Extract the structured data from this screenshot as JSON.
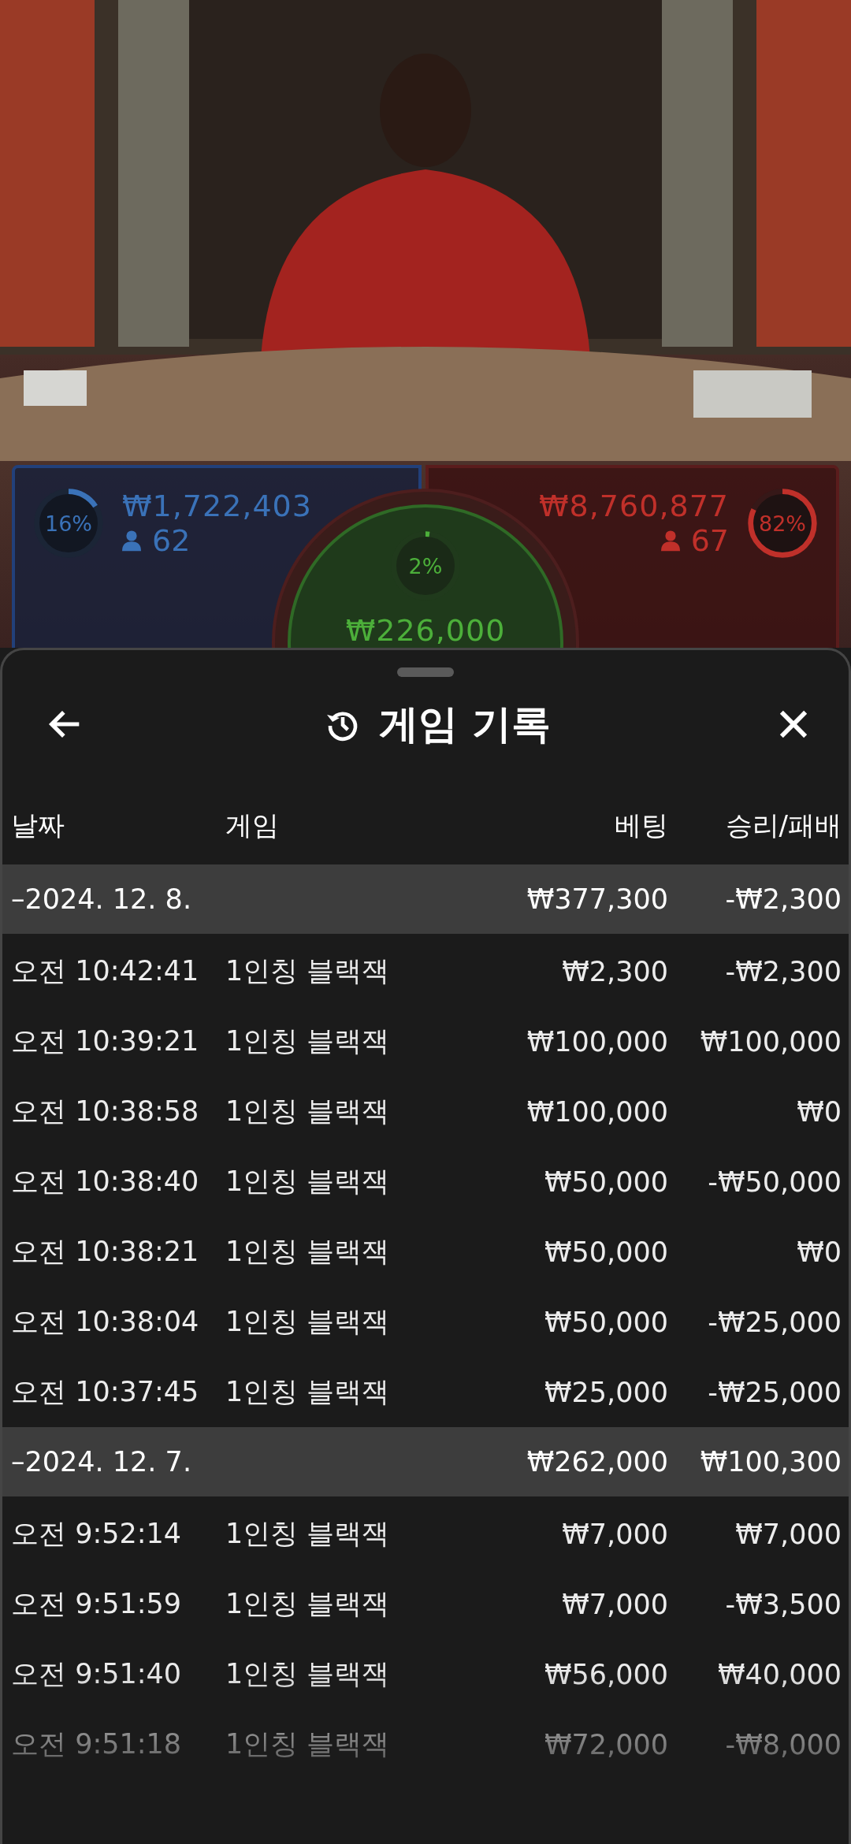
{
  "bets": {
    "player": {
      "percent": "16%",
      "level": 0.16,
      "amount": "₩1,722,403",
      "count": "62"
    },
    "tie": {
      "percent": "2%",
      "level": 0.02,
      "amount": "₩226,000"
    },
    "banker": {
      "percent": "82%",
      "level": 0.82,
      "amount": "₩8,760,877",
      "count": "67"
    }
  },
  "sheet": {
    "title": "게임 기록",
    "columns": [
      "날짜",
      "게임",
      "베팅",
      "승리/패배"
    ],
    "groups": [
      {
        "date": "–2024. 12. 8.",
        "bet": "₩377,300",
        "result": "-₩2,300",
        "rows": [
          {
            "time": "오전 10:42:41",
            "game": "1인칭 블랙잭",
            "bet": "₩2,300",
            "result": "-₩2,300"
          },
          {
            "time": "오전 10:39:21",
            "game": "1인칭 블랙잭",
            "bet": "₩100,000",
            "result": "₩100,000"
          },
          {
            "time": "오전 10:38:58",
            "game": "1인칭 블랙잭",
            "bet": "₩100,000",
            "result": "₩0"
          },
          {
            "time": "오전 10:38:40",
            "game": "1인칭 블랙잭",
            "bet": "₩50,000",
            "result": "-₩50,000"
          },
          {
            "time": "오전 10:38:21",
            "game": "1인칭 블랙잭",
            "bet": "₩50,000",
            "result": "₩0"
          },
          {
            "time": "오전 10:38:04",
            "game": "1인칭 블랙잭",
            "bet": "₩50,000",
            "result": "-₩25,000"
          },
          {
            "time": "오전 10:37:45",
            "game": "1인칭 블랙잭",
            "bet": "₩25,000",
            "result": "-₩25,000"
          }
        ]
      },
      {
        "date": "–2024. 12. 7.",
        "bet": "₩262,000",
        "result": "₩100,300",
        "rows": [
          {
            "time": "오전 9:52:14",
            "game": "1인칭 블랙잭",
            "bet": "₩7,000",
            "result": "₩7,000"
          },
          {
            "time": "오전 9:51:59",
            "game": "1인칭 블랙잭",
            "bet": "₩7,000",
            "result": "-₩3,500"
          },
          {
            "time": "오전 9:51:40",
            "game": "1인칭 블랙잭",
            "bet": "₩56,000",
            "result": "₩40,000"
          },
          {
            "time": "오전 9:51:18",
            "game": "1인칭 블랙잭",
            "bet": "₩72,000",
            "result": "-₩8,000"
          }
        ]
      }
    ]
  }
}
